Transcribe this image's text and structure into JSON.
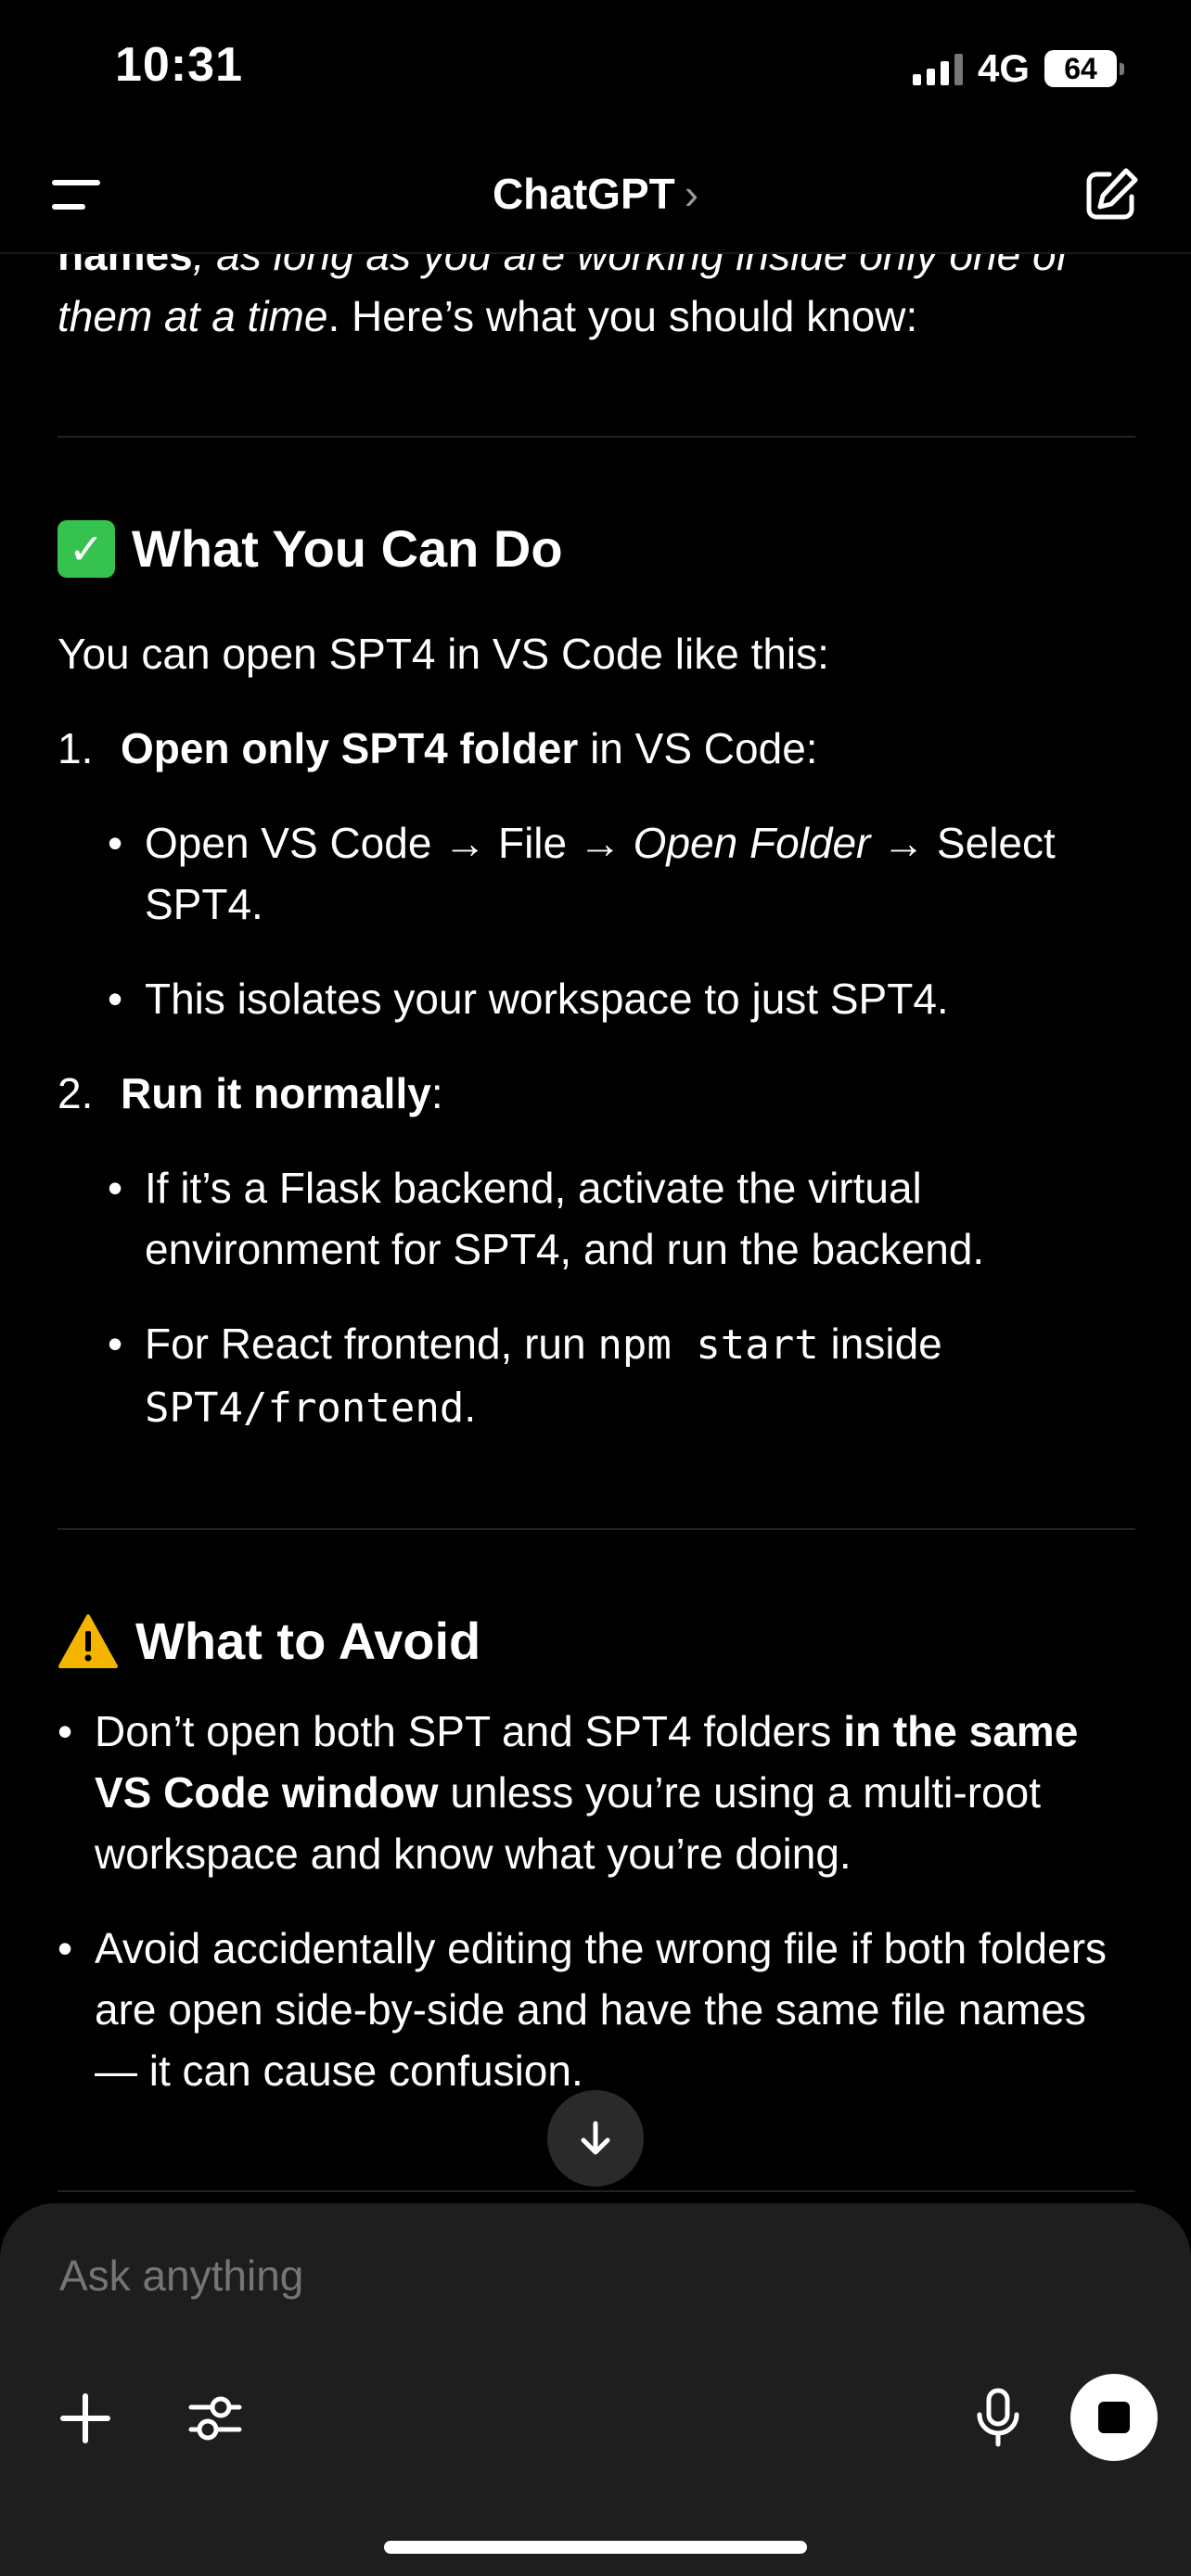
{
  "status": {
    "time": "10:31",
    "network": "4G",
    "battery": "64"
  },
  "header": {
    "title": "ChatGPT",
    "chevron": "›"
  },
  "content": {
    "intro_clip_bold": "names",
    "intro_clip_rest": ", as long as you are working inside only one of",
    "intro_italic": "them at a time",
    "intro_rest": ". Here’s what you should know:",
    "section1": {
      "heading": "What You Can Do",
      "lead": "You can open SPT4 in VS Code like this:",
      "items": [
        {
          "num": "1.",
          "bold": "Open only SPT4 folder",
          "rest": " in VS Code:",
          "bullets": [
            {
              "a": "Open VS Code → File → ",
              "i": "Open Folder",
              "b": " → Select SPT4."
            },
            {
              "a": "This isolates your workspace to just SPT4."
            }
          ]
        },
        {
          "num": "2.",
          "bold": "Run it normally",
          "rest": ":",
          "bullets": [
            {
              "a": "If it’s a Flask backend, activate the virtual environment for SPT4, and run the backend."
            },
            {
              "a": "For React frontend, run ",
              "code1": "npm start",
              "b": " inside ",
              "code2": "SPT4/frontend",
              "c": "."
            }
          ]
        }
      ]
    },
    "section2": {
      "heading": "What to Avoid",
      "bullets": [
        {
          "a": "Don’t open both SPT and SPT4 folders ",
          "bold": "in the same VS Code window",
          "b": " unless you’re using a multi-root workspace and know what you’re doing."
        },
        {
          "a": "Avoid accidentally editing the wrong file if both folders are open side-by-side and have the same file names — it can cause confusion."
        }
      ]
    }
  },
  "composer": {
    "placeholder": "Ask anything"
  },
  "icons": {
    "menu": "menu-icon",
    "compose": "compose-icon",
    "scroll": "arrow-down-icon",
    "plus": "plus-icon",
    "tools": "sliders-icon",
    "mic": "microphone-icon",
    "stop": "stop-icon",
    "check": "check-mark-icon",
    "warning": "warning-icon"
  },
  "colors": {
    "background": "#000000",
    "composer": "#1e1e1e",
    "check": "#36c24e",
    "warning": "#f5b400"
  }
}
